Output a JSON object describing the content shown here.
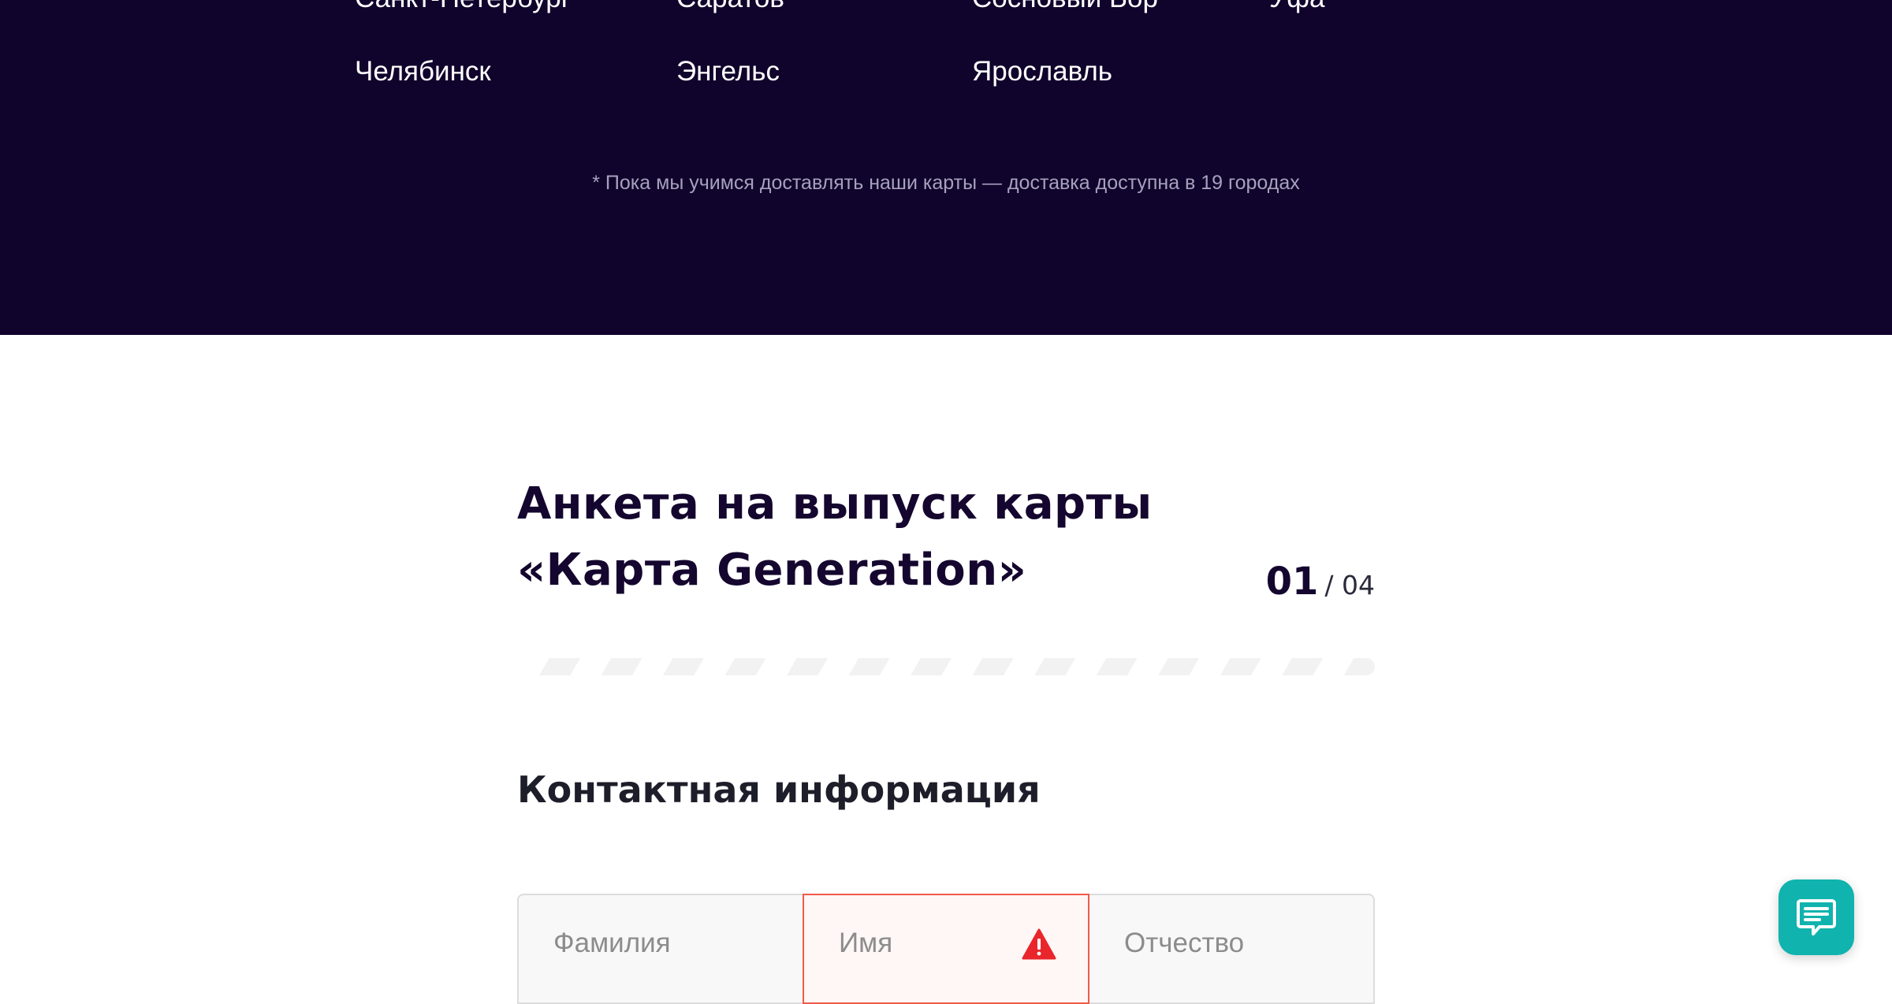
{
  "cities": {
    "row0": [
      "Санкт-Петербург",
      "Саратов",
      "Сосновый Бор",
      "Уфа"
    ],
    "row1": [
      "Челябинск",
      "Энгельс",
      "Ярославль"
    ]
  },
  "delivery_note": "* Пока мы учимся доставлять наши карты — доставка доступна в 19 городах",
  "form": {
    "title": "Анкета на выпуск карты «Карта Generation»",
    "step_current": "01",
    "step_total": "/ 04",
    "progress_fraction": 0.0,
    "section_title": "Контактная информация",
    "fields": {
      "last_name_placeholder": "Фамилия",
      "first_name_placeholder": "Имя",
      "middle_name_placeholder": "Отчество"
    }
  },
  "icons": {
    "first_name_status": "warning-icon",
    "chat": "chat-icon"
  },
  "colors": {
    "band_background": "#10032c",
    "error": "#f15a4a",
    "warning_icon": "#e8262b",
    "chat_button": "#10b3ad"
  }
}
